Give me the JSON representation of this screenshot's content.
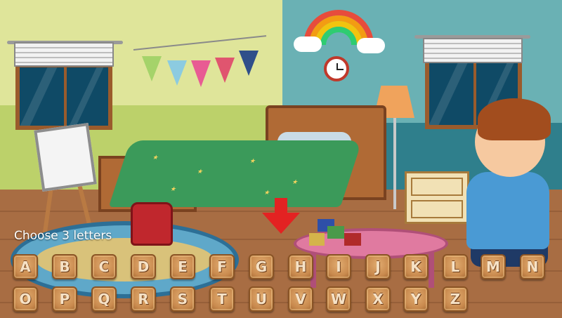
{
  "prompt": "Choose 3 letters",
  "row1": [
    "A",
    "B",
    "C",
    "D",
    "E",
    "F",
    "G",
    "H",
    "I",
    "J",
    "K",
    "L",
    "M",
    "N"
  ],
  "row2": [
    "O",
    "P",
    "Q",
    "R",
    "S",
    "T",
    "U",
    "V",
    "W",
    "X",
    "Y",
    "Z"
  ],
  "colors": {
    "tile": "#c98a4e",
    "arrow": "#e32222",
    "prompt": "#ffffff"
  }
}
